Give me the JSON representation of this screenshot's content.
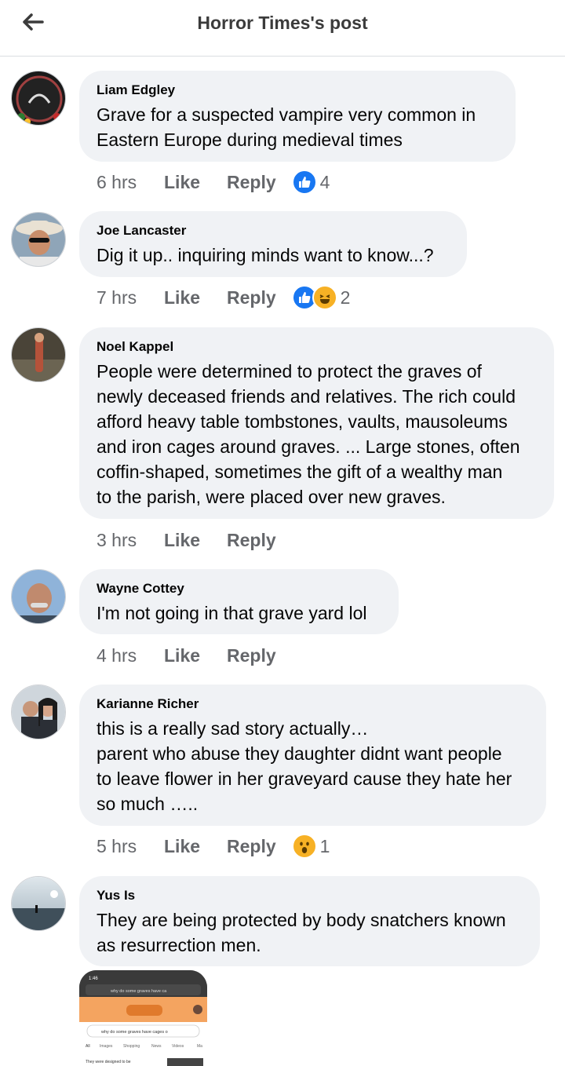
{
  "header": {
    "title": "Horror Times's post"
  },
  "actions": {
    "like": "Like",
    "reply": "Reply"
  },
  "comments": [
    {
      "author": "Liam Edgley",
      "text": "Grave for a suspected vampire very common in\nEastern Europe during medieval times",
      "time": "6 hrs",
      "reaction_count": "4",
      "reactions": [
        "like-reaction-icon"
      ]
    },
    {
      "author": "Joe Lancaster",
      "text": "Dig it up.. inquiring minds want to know...?",
      "time": "7 hrs",
      "reaction_count": "2",
      "reactions": [
        "like-reaction-icon",
        "haha-reaction-icon"
      ]
    },
    {
      "author": "Noel Kappel",
      "text": "People were determined to protect the graves of\nnewly deceased friends and relatives. The rich could\nafford heavy table tombstones, vaults, mausoleums\nand iron cages around graves. ... Large stones, often\ncoffin-shaped, sometimes the gift of a wealthy man\nto the parish, were placed over new graves.",
      "time": "3 hrs"
    },
    {
      "author": "Wayne Cottey",
      "text": "I'm not going in that grave yard lol",
      "time": "4 hrs"
    },
    {
      "author": "Karianne Richer",
      "text": "this is a really sad story actually…\nparent who abuse they daughter didnt want people\nto leave flower in her graveyard cause they hate her\nso much …..",
      "time": "5 hrs",
      "reaction_count": "1",
      "reactions": [
        "wow-reaction-icon"
      ]
    },
    {
      "author": "Yus Is",
      "text": "They are being protected by body snatchers known\nas resurrection men."
    }
  ],
  "attachment": {
    "status_time": "1:46",
    "url_text": "why do some graves have ca",
    "search_text": "why do some graves have cages o",
    "tabs": [
      "All",
      "Images",
      "Shopping",
      "News",
      "Videos",
      "Ma"
    ],
    "snippet": "They were designed to be"
  },
  "colors": {
    "like_blue": "#1877f2",
    "haha_yellow": "#f7b125",
    "bubble_bg": "#f0f2f5",
    "meta_gray": "#65676b"
  }
}
